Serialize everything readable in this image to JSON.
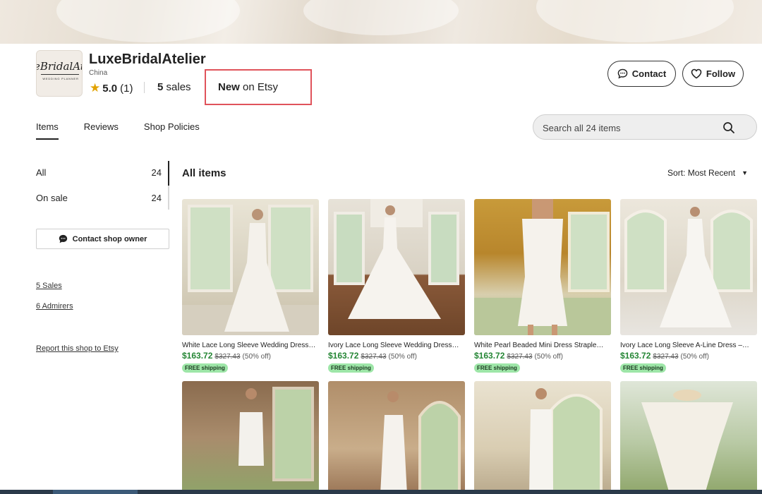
{
  "shop": {
    "logo_text": "eBridalAte",
    "logo_subtext": "WEDDING PLANNER",
    "name": "LuxeBridalAtelier",
    "location": "China",
    "rating_score": "5.0",
    "rating_count": "(1)",
    "sales_count": "5",
    "sales_label": "sales",
    "new_label": "New",
    "new_suffix": "on Etsy"
  },
  "actions": {
    "contact_label": "Contact",
    "follow_label": "Follow"
  },
  "tabs": [
    {
      "label": "Items",
      "active": true
    },
    {
      "label": "Reviews",
      "active": false
    },
    {
      "label": "Shop Policies",
      "active": false
    }
  ],
  "search": {
    "placeholder": "Search all 24 items"
  },
  "sidebar": {
    "sections": [
      {
        "label": "All",
        "count": "24"
      },
      {
        "label": "On sale",
        "count": "24"
      }
    ],
    "contact_owner_label": "Contact shop owner",
    "sales_link": "5 Sales",
    "admirers_link": "6 Admirers",
    "report_link": "Report this shop to Etsy"
  },
  "listing": {
    "heading": "All items",
    "sort_label": "Sort: Most Recent"
  },
  "items": [
    {
      "title": "White Lace Long Sleeve Wedding Dress…",
      "price": "$163.72",
      "original": "$327.43",
      "discount": "(50% off)",
      "shipping": "FREE shipping"
    },
    {
      "title": "Ivory Lace Long Sleeve Wedding Dress…",
      "price": "$163.72",
      "original": "$327.43",
      "discount": "(50% off)",
      "shipping": "FREE shipping"
    },
    {
      "title": "White Pearl Beaded Mini Dress Straple…",
      "price": "$163.72",
      "original": "$327.43",
      "discount": "(50% off)",
      "shipping": "FREE shipping"
    },
    {
      "title": "Ivory Lace Long Sleeve A-Line Dress –…",
      "price": "$163.72",
      "original": "$327.43",
      "discount": "(50% off)",
      "shipping": "FREE shipping"
    }
  ],
  "colors": {
    "price_green": "#258635",
    "shipping_badge": "#9ee6a8",
    "highlight_box": "#e0535b",
    "star": "#e2a200"
  }
}
